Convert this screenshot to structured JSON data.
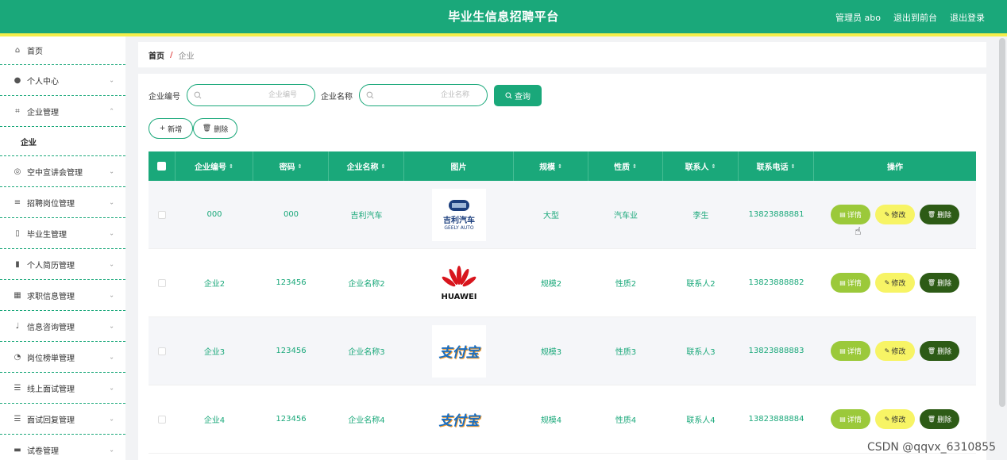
{
  "header": {
    "title": "毕业生信息招聘平台",
    "user": "管理员 abo",
    "to_front": "退出到前台",
    "logout": "退出登录",
    "brand_color": "#1aa87a",
    "accent_line_color": "#f4ee4a"
  },
  "sidebar": {
    "items": [
      {
        "label": "首页",
        "icon": "home-icon",
        "chevron": false
      },
      {
        "label": "个人中心",
        "icon": "user-icon",
        "chevron": "down"
      },
      {
        "label": "企业管理",
        "icon": "crop-icon",
        "chevron": "up"
      },
      {
        "label": "企业",
        "icon": "",
        "chevron": false,
        "sub": true
      },
      {
        "label": "空中宣讲会管理",
        "icon": "globe-icon",
        "chevron": "down"
      },
      {
        "label": "招聘岗位管理",
        "icon": "sliders-icon",
        "chevron": "down"
      },
      {
        "label": "毕业生管理",
        "icon": "badge-icon",
        "chevron": "down"
      },
      {
        "label": "个人简历管理",
        "icon": "bar-chart-icon",
        "chevron": "down"
      },
      {
        "label": "求职信息管理",
        "icon": "grid-icon",
        "chevron": "down"
      },
      {
        "label": "信息咨询管理",
        "icon": "mic-icon",
        "chevron": "down"
      },
      {
        "label": "岗位榜単管理",
        "icon": "dashboard-icon",
        "chevron": "down"
      },
      {
        "label": "线上面试管理",
        "icon": "list-icon",
        "chevron": "down"
      },
      {
        "label": "面试回复管理",
        "icon": "list-icon",
        "chevron": "down"
      },
      {
        "label": "试卷管理",
        "icon": "monitor-icon",
        "chevron": "down"
      }
    ]
  },
  "breadcrumb": {
    "home": "首页",
    "sep": "/",
    "current": "企业"
  },
  "search": {
    "code_label": "企业编号",
    "code_placeholder": "企业编号",
    "name_label": "企业名称",
    "name_placeholder": "企业名称",
    "query_label": "查询"
  },
  "actions": {
    "add_label": "新增",
    "delete_label": "删除"
  },
  "table": {
    "headers": [
      "企业编号",
      "密码",
      "企业名称",
      "图片",
      "规模",
      "性质",
      "联系人",
      "联系电话",
      "操作"
    ],
    "rows": [
      {
        "code": "000",
        "password": "000",
        "name": "吉利汽车",
        "logo": "GEELY AUTO",
        "logo_cn": "吉利汽车",
        "scale": "大型",
        "nature": "汽车业",
        "contact": "李生",
        "phone": "13823888881"
      },
      {
        "code": "企业2",
        "password": "123456",
        "name": "企业名称2",
        "logo": "HUAWEI",
        "logo_cn": "",
        "scale": "规模2",
        "nature": "性质2",
        "contact": "联系人2",
        "phone": "13823888882"
      },
      {
        "code": "企业3",
        "password": "123456",
        "name": "企业名称3",
        "logo": "",
        "logo_cn": "支付宝",
        "scale": "规模3",
        "nature": "性质3",
        "contact": "联系人3",
        "phone": "13823888883"
      },
      {
        "code": "企业4",
        "password": "123456",
        "name": "企业名称4",
        "logo": "",
        "logo_cn": "支付宝",
        "scale": "规模4",
        "nature": "性质4",
        "contact": "联系人4",
        "phone": "13823888884"
      }
    ],
    "op_detail": "详情",
    "op_edit": "修改",
    "op_delete": "删除"
  },
  "watermark": "CSDN @qqvx_6310855"
}
